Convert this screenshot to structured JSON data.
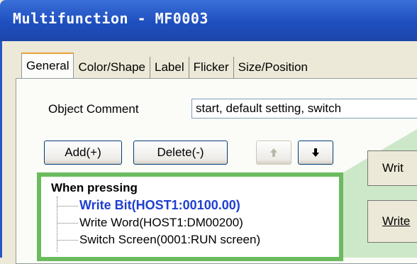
{
  "window": {
    "title": "Multifunction - MF0003"
  },
  "tabs": [
    {
      "label": "General",
      "active": true
    },
    {
      "label": "Color/Shape",
      "active": false
    },
    {
      "label": "Label",
      "active": false
    },
    {
      "label": "Flicker",
      "active": false
    },
    {
      "label": "Size/Position",
      "active": false
    }
  ],
  "object_comment": {
    "label": "Object Comment",
    "value": "start, default setting, switch"
  },
  "toolbar": {
    "add_label": "Add(+)",
    "delete_label": "Delete(-)",
    "up_icon": "arrow-up-icon",
    "down_icon": "arrow-down-icon"
  },
  "tree": {
    "root": "When pressing",
    "items": [
      {
        "label": "Write Bit(HOST1:00100.00)",
        "selected": true
      },
      {
        "label": "Write Word(HOST1:DM00200)",
        "selected": false
      },
      {
        "label": "Switch Screen(0001:RUN screen)",
        "selected": false
      }
    ]
  },
  "right_buttons": [
    {
      "label": "Writ"
    },
    {
      "label": "Write"
    }
  ],
  "colors": {
    "titlebar": "#1f4fbf",
    "highlight_border": "#6bbb5e",
    "selected_text": "#1f3fcf"
  }
}
